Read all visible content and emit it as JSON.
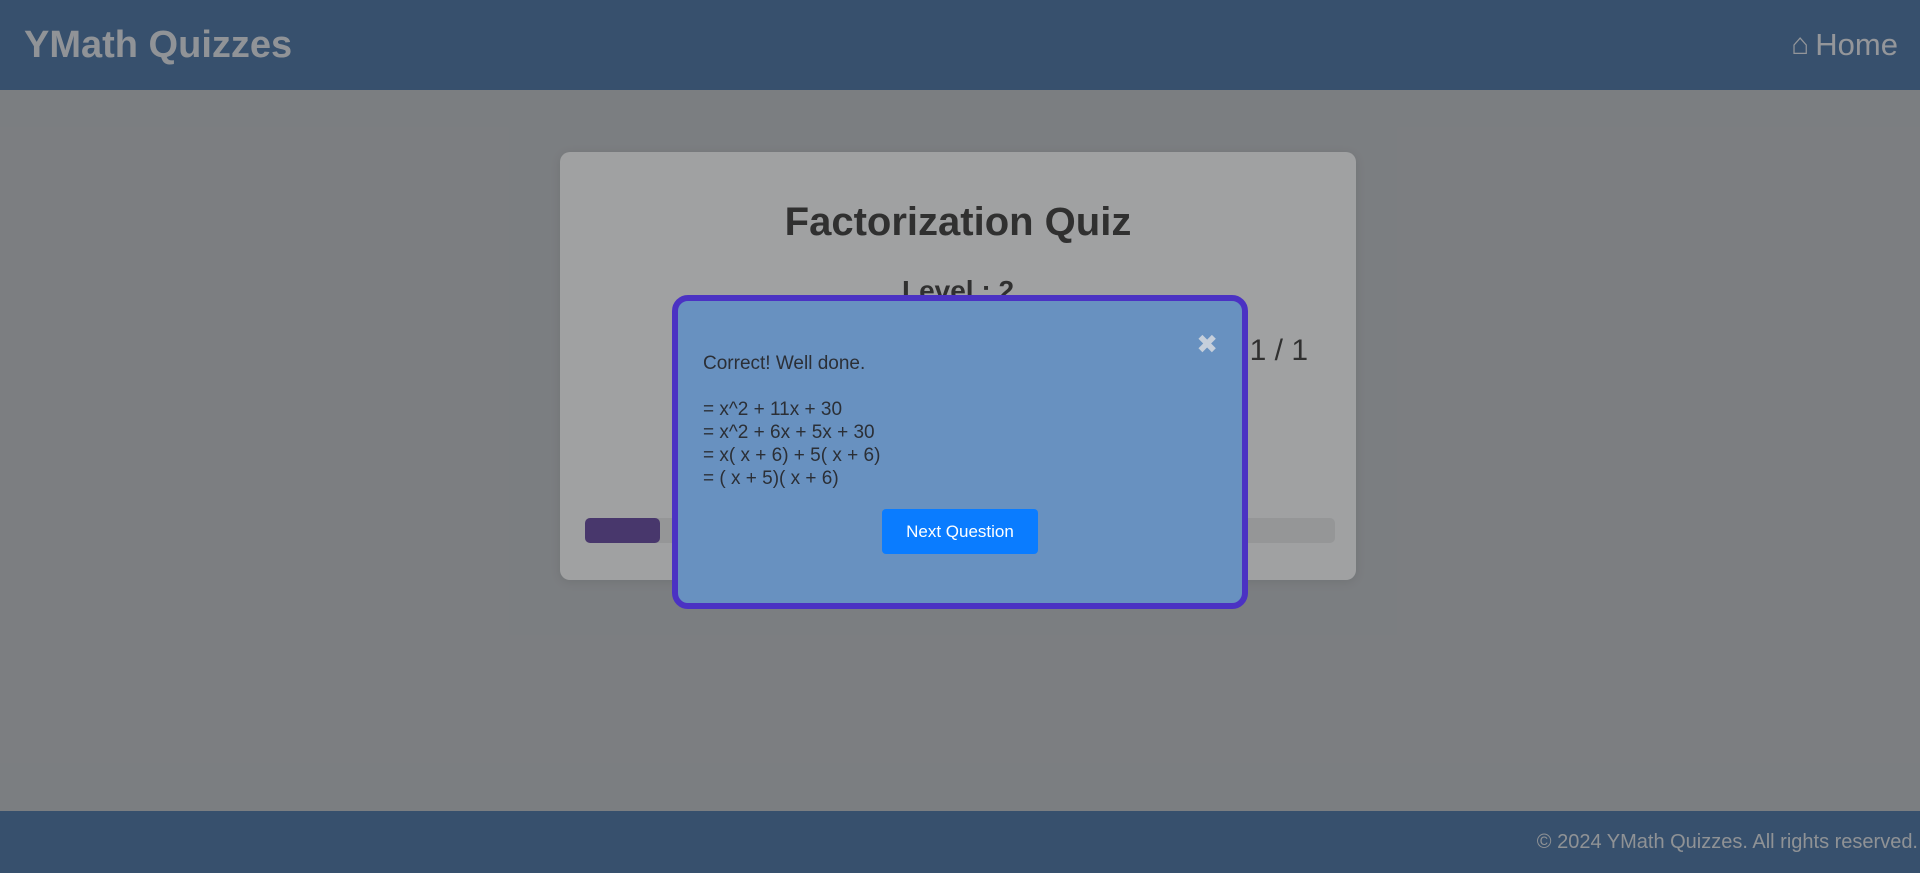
{
  "header": {
    "brand": "YMath Quizzes",
    "home_icon": "⌂",
    "home_label": "Home"
  },
  "quiz": {
    "title": "Factorization Quiz",
    "level": "Level : 2",
    "counter": "1 / 1",
    "progress_fraction": 0.1
  },
  "footer": {
    "copyright": "© 2024 YMath Quizzes. All rights reserved."
  },
  "modal": {
    "close_icon": "✖",
    "message": "Correct! Well done.",
    "steps": [
      "= x^2 + 11x + 30",
      "= x^2 + 6x + 5x + 30",
      "= x( x + 6) + 5( x + 6)",
      "= ( x + 5)( x + 6)"
    ],
    "next_label": "Next Question"
  },
  "colors": {
    "header_bg": "#2c5a8f",
    "modal_bg": "#6891c0",
    "modal_border": "#4b32c3",
    "button_bg": "#0a7cff",
    "progress_fill": "#4b2b8c"
  }
}
